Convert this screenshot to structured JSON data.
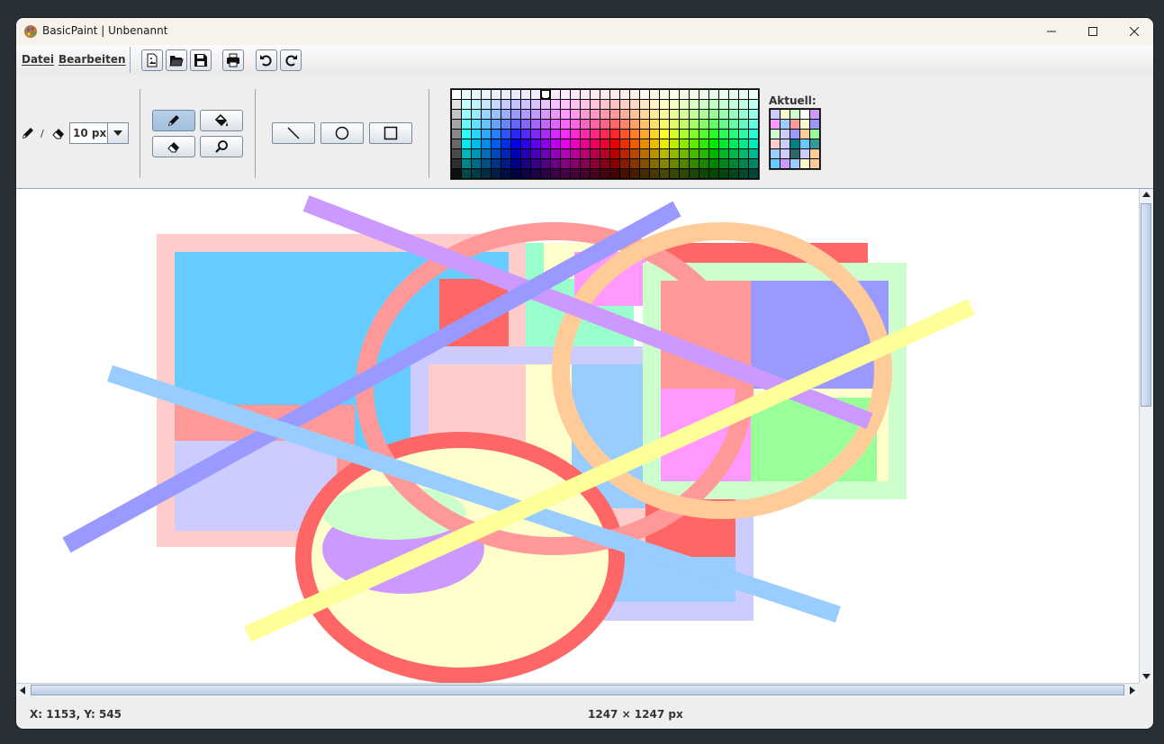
{
  "window": {
    "title": "BasicPaint | Unbenannt"
  },
  "menu": {
    "file": "Datei",
    "edit": "Bearbeiten"
  },
  "toolbar": {
    "icons": [
      "new-image-icon",
      "open-folder-icon",
      "save-icon",
      "print-icon",
      "undo-icon",
      "redo-icon"
    ]
  },
  "tools": {
    "pen_eraser_separator": "/",
    "brush_size": "10 px",
    "active_tool": "pencil"
  },
  "palette": {
    "current_label": "Aktuell:",
    "selected_color": "#9999ff"
  },
  "status": {
    "cursor": "X: 1153, Y: 545",
    "image_size": "1247 × 1247 px"
  },
  "colors": {
    "accent": "#8ea3bd",
    "canvas_bg": "#ffffff"
  }
}
